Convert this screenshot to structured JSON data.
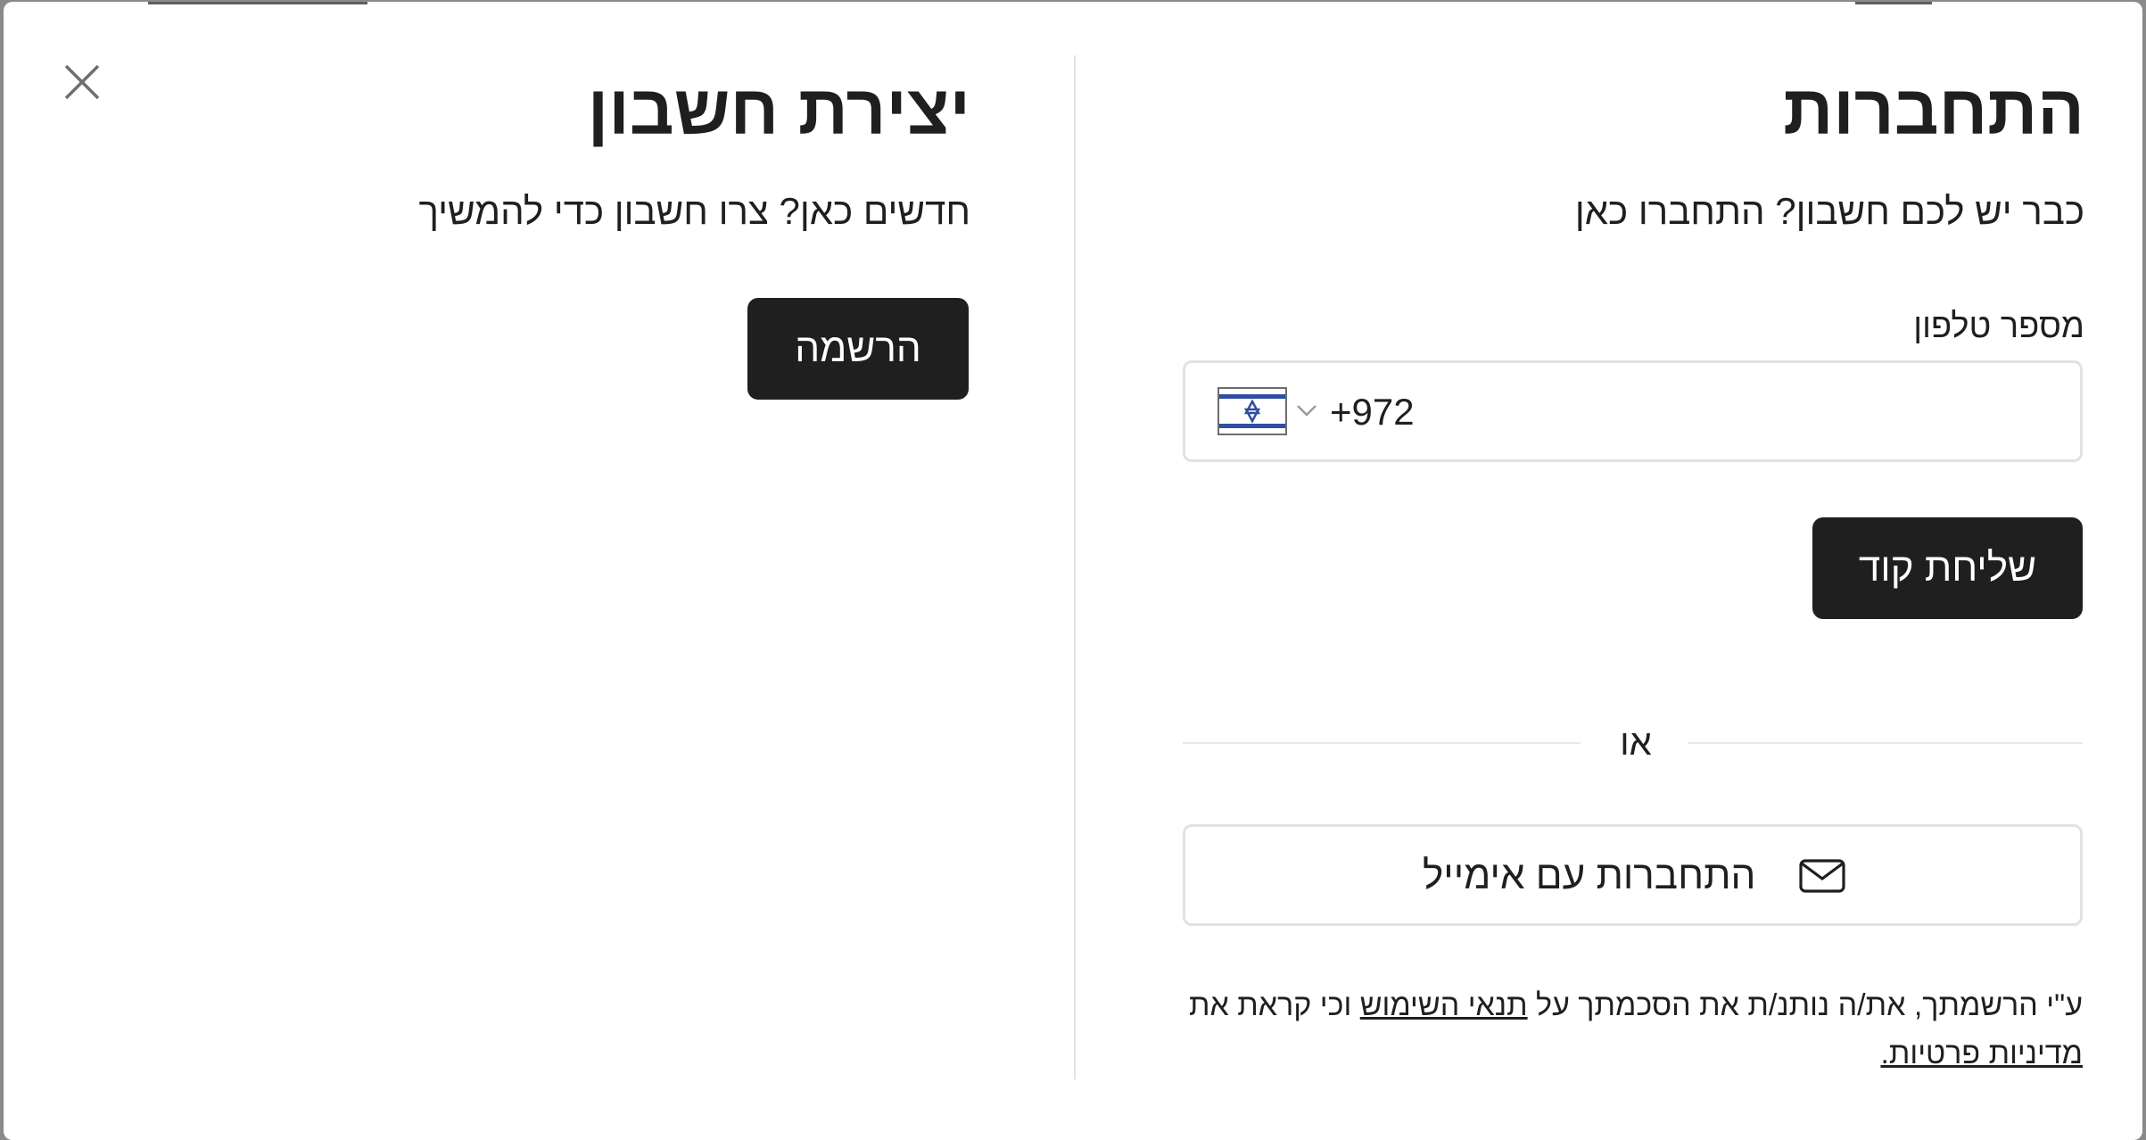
{
  "modal": {
    "close_label": "close"
  },
  "login": {
    "title": "התחברות",
    "subtitle": "כבר יש לכם חשבון? התחברו כאן",
    "phone_label": "מספר טלפון",
    "phone_value": "+972",
    "country": "Israel",
    "send_code_label": "שליחת קוד",
    "or_text": "או",
    "email_login_label": "התחברות עם אימייל",
    "terms_prefix": "ע\"י הרשמתך, את/ה נותנ/ת את הסכמתך על ",
    "terms_link": "תנאי השימוש",
    "terms_middle": " וכי קראת את ",
    "privacy_link": "מדיניות פרטיות."
  },
  "signup": {
    "title": "יצירת חשבון",
    "subtitle": "חדשים כאן? צרו חשבון כדי להמשיך",
    "register_label": "הרשמה"
  },
  "colors": {
    "primary_button": "#1f1f1f",
    "border": "#e2e2e2",
    "flag_blue": "#2f4ea3"
  }
}
